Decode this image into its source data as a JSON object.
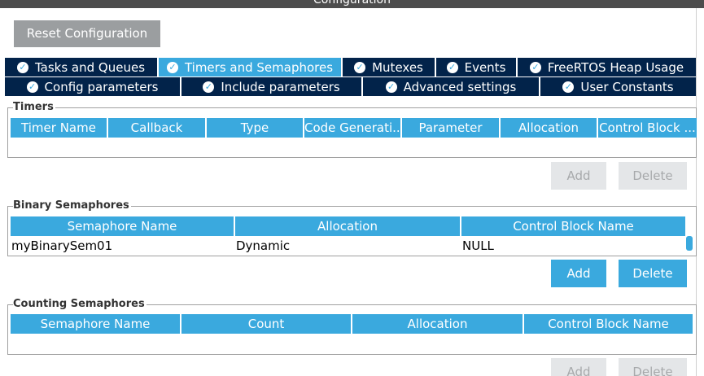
{
  "window": {
    "title": "Configuration"
  },
  "reset_button": "Reset Configuration",
  "tabs_row1": [
    {
      "label": "Tasks and Queues",
      "active": false
    },
    {
      "label": "Timers and Semaphores",
      "active": true
    },
    {
      "label": "Mutexes",
      "active": false
    },
    {
      "label": "Events",
      "active": false
    },
    {
      "label": "FreeRTOS Heap Usage",
      "active": false
    }
  ],
  "tabs_row2": [
    {
      "label": "Config parameters"
    },
    {
      "label": "Include parameters"
    },
    {
      "label": "Advanced settings"
    },
    {
      "label": "User Constants"
    }
  ],
  "timers": {
    "title": "Timers",
    "columns": [
      "Timer Name",
      "Callback",
      "Type",
      "Code Generati...",
      "Parameter",
      "Allocation",
      "Control Block ..."
    ],
    "add": "Add",
    "delete": "Delete"
  },
  "binary": {
    "title": "Binary Semaphores",
    "columns": [
      "Semaphore Name",
      "Allocation",
      "Control Block Name"
    ],
    "rows": [
      {
        "name": "myBinarySem01",
        "allocation": "Dynamic",
        "control_block": "NULL"
      }
    ],
    "add": "Add",
    "delete": "Delete"
  },
  "counting": {
    "title": "Counting Semaphores",
    "columns": [
      "Semaphore Name",
      "Count",
      "Allocation",
      "Control Block Name"
    ],
    "add": "Add",
    "delete": "Delete"
  },
  "colors": {
    "accent": "#3aa9de",
    "navy": "#02234a",
    "disabled_btn": "#e4e6e8"
  }
}
